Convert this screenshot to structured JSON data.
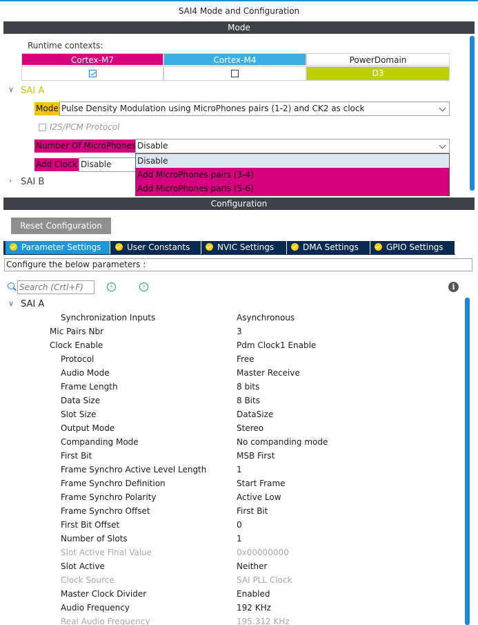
{
  "window": {
    "title": "SAI4 Mode and Configuration"
  },
  "mode_section": {
    "header": "Mode",
    "runtime_label": "Runtime contexts:",
    "contexts": [
      {
        "label": "Cortex-M7",
        "color": "#d6007e",
        "checked": true
      },
      {
        "label": "Cortex-M4",
        "color": "#3aaee0",
        "checked": false
      },
      {
        "label": "PowerDomain",
        "color": "#ffffff",
        "value": "D3",
        "value_color": "#bccf00"
      }
    ],
    "sai_a": {
      "label": "SAI A",
      "mode_label": "Mode",
      "mode_value": "Pulse Density Modulation using MicroPhones pairs (1-2) and CK2 as clock",
      "i2s_label": "I2S/PCM Protocol",
      "mic_label": "Number Of MicroPhones",
      "mic_value": "Disable",
      "addclock_label": "Add Clock",
      "addclock_value": "Disable",
      "dropdown_options": [
        "Disable",
        "Add MicroPhones pairs (3-4)",
        "Add MicroPhones paris (5-6)"
      ]
    },
    "sai_b": {
      "label": "SAI B"
    }
  },
  "config_section": {
    "header": "Configuration",
    "reset_label": "Reset Configuration",
    "tabs": [
      "Parameter Settings",
      "User Constants",
      "NVIC Settings",
      "DMA Settings",
      "GPIO Settings"
    ],
    "active_tab": 0,
    "hint": "Configure the below parameters :",
    "search_placeholder": "Search (Crtl+F)",
    "group_label": "SAI A",
    "params": [
      {
        "key": "Synchronization Inputs",
        "value": "Asynchronous",
        "indent": 2,
        "disabled": false
      },
      {
        "key": "Mic Pairs Nbr",
        "value": "3",
        "indent": 1,
        "disabled": false
      },
      {
        "key": "Clock Enable",
        "value": "Pdm Clock1 Enable",
        "indent": 1,
        "disabled": false
      },
      {
        "key": "Protocol",
        "value": "Free",
        "indent": 2,
        "disabled": false
      },
      {
        "key": "Audio Mode",
        "value": "Master Receive",
        "indent": 2,
        "disabled": false
      },
      {
        "key": "Frame Length",
        "value": "8 bits",
        "indent": 2,
        "disabled": false
      },
      {
        "key": "Data Size",
        "value": "8 Bits",
        "indent": 2,
        "disabled": false
      },
      {
        "key": "Slot Size",
        "value": "DataSize",
        "indent": 2,
        "disabled": false
      },
      {
        "key": "Output Mode",
        "value": "Stereo",
        "indent": 2,
        "disabled": false
      },
      {
        "key": "Companding Mode",
        "value": "No companding mode",
        "indent": 2,
        "disabled": false
      },
      {
        "key": "First Bit",
        "value": "MSB First",
        "indent": 2,
        "disabled": false
      },
      {
        "key": "Frame Synchro Active Level Length",
        "value": "1",
        "indent": 2,
        "disabled": false
      },
      {
        "key": "Frame Synchro Definition",
        "value": "Start Frame",
        "indent": 2,
        "disabled": false
      },
      {
        "key": "Frame Synchro Polarity",
        "value": "Active Low",
        "indent": 2,
        "disabled": false
      },
      {
        "key": "Frame Synchro Offset",
        "value": "First Bit",
        "indent": 2,
        "disabled": false
      },
      {
        "key": "First Bit Offset",
        "value": "0",
        "indent": 2,
        "disabled": false
      },
      {
        "key": "Number of Slots",
        "value": "1",
        "indent": 2,
        "disabled": false
      },
      {
        "key": "Slot Active Final Value",
        "value": "0x00000000",
        "indent": 2,
        "disabled": true
      },
      {
        "key": "Slot Active",
        "value": "Neither",
        "indent": 2,
        "disabled": false
      },
      {
        "key": "Clock Source",
        "value": "SAI PLL Clock",
        "indent": 2,
        "disabled": true
      },
      {
        "key": "Master Clock Divider",
        "value": "Enabled",
        "indent": 2,
        "disabled": false
      },
      {
        "key": "Audio Frequency",
        "value": "192 KHz",
        "indent": 2,
        "disabled": false
      },
      {
        "key": "Real Audio Frequency",
        "value": "195.312 KHz",
        "indent": 2,
        "disabled": true
      }
    ]
  }
}
